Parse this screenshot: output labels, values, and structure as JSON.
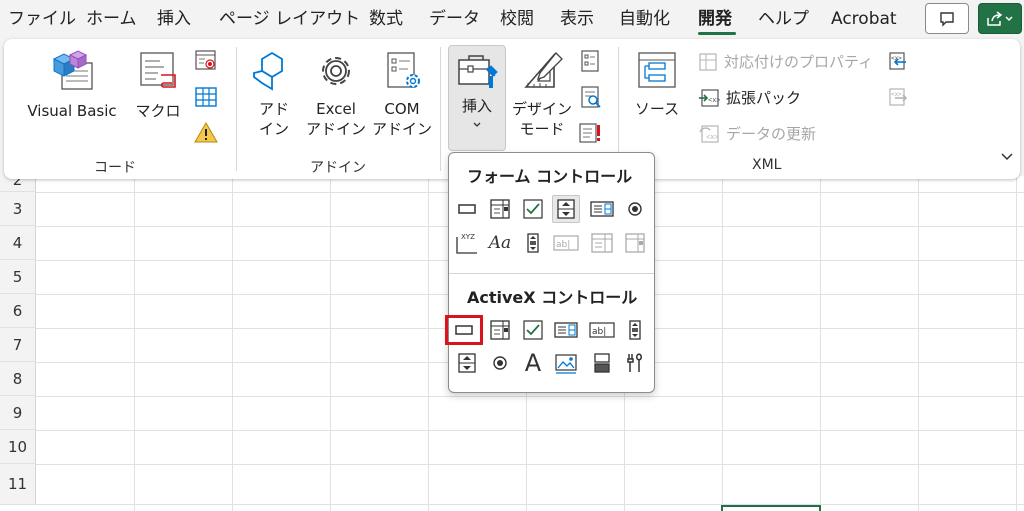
{
  "tabs": [
    {
      "label": "ファイル"
    },
    {
      "label": "ホーム"
    },
    {
      "label": "挿入"
    },
    {
      "label": "ページ レイアウト"
    },
    {
      "label": "数式"
    },
    {
      "label": "データ"
    },
    {
      "label": "校閲"
    },
    {
      "label": "表示"
    },
    {
      "label": "自動化"
    },
    {
      "label": "開発",
      "active": true
    },
    {
      "label": "ヘルプ"
    },
    {
      "label": "Acrobat"
    }
  ],
  "toolbar": {
    "comment_icon": "comment-icon",
    "share_icon": "share-icon"
  },
  "ribbon": {
    "code": {
      "group_label": "コード",
      "visual_basic": "Visual Basic",
      "macro": "マクロ"
    },
    "addins": {
      "group_label": "アドイン",
      "addin_line1": "アド",
      "addin_line2": "イン",
      "excel_addin_line1": "Excel",
      "excel_addin_line2": "アドイン",
      "com_addin_line1": "COM",
      "com_addin_line2": "アドイン"
    },
    "controls": {
      "insert_label": "挿入",
      "design_mode_line1": "デザイン",
      "design_mode_line2": "モード"
    },
    "xml": {
      "group_label": "XML",
      "source": "ソース",
      "map_properties": "対応付けのプロパティ",
      "expansion_pack": "拡張パック",
      "refresh_data": "データの更新"
    }
  },
  "dropdown": {
    "form_controls_title": "フォーム コントロール",
    "activex_controls_title": "ActiveX コントロール",
    "form_controls_label_glyph": "Aa",
    "activex_label_glyph": "A",
    "textbox_glyph": "ab|",
    "groupbox_glyph": "XYZ"
  },
  "grid": {
    "rows": [
      "2",
      "3",
      "4",
      "5",
      "6",
      "7",
      "8",
      "9",
      "10",
      "11"
    ]
  },
  "colors": {
    "accent": "#217346",
    "highlight_box": "#d9141d",
    "vb_blue": "#0078d4"
  }
}
